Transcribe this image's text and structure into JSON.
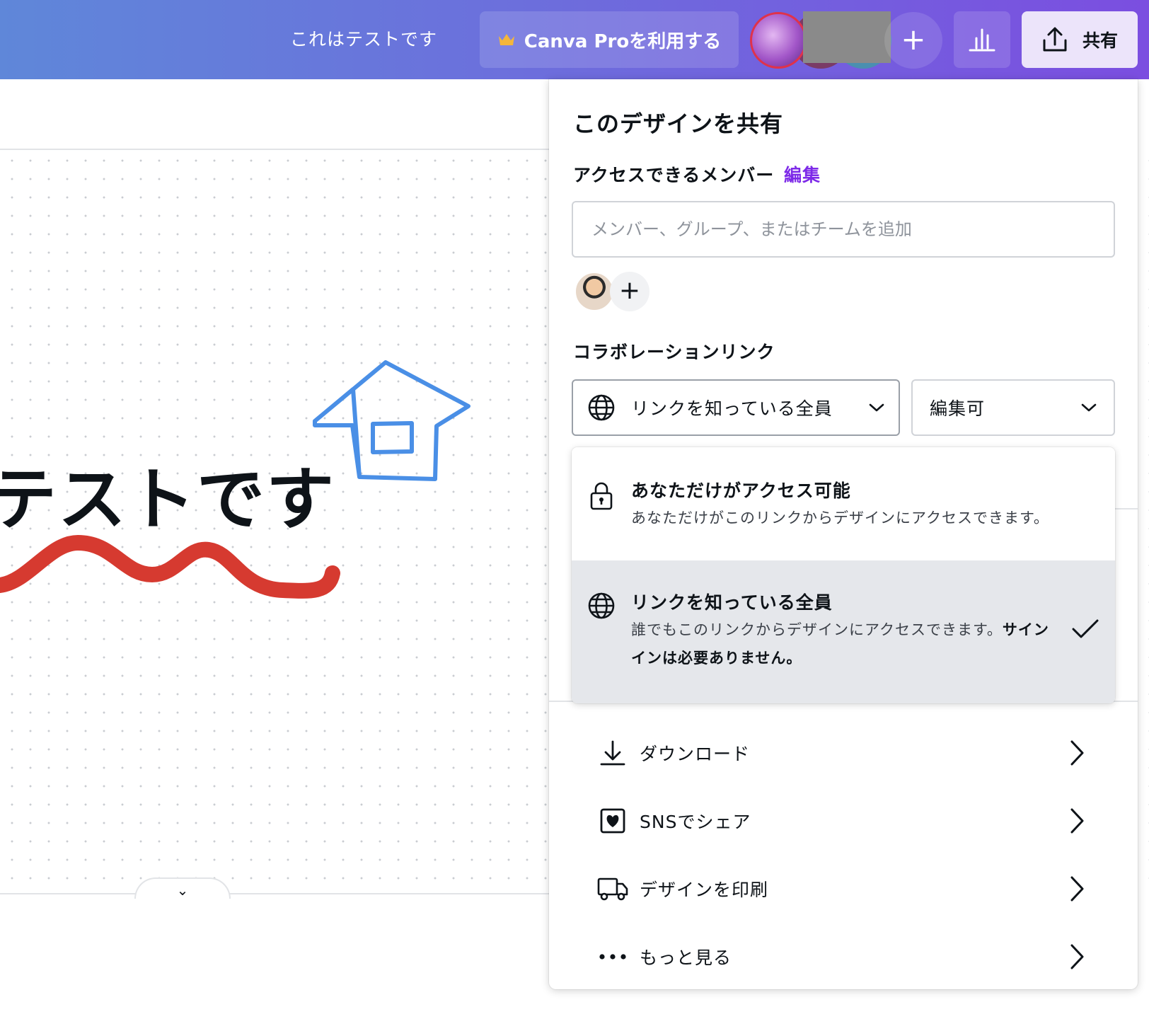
{
  "topbar": {
    "doc_title": "これはテストです",
    "pro_button": "Canva Proを利用する",
    "add_icon": "plus-icon",
    "insights_icon": "bar-chart-icon",
    "share_button": "共有",
    "share_icon": "upload-icon"
  },
  "canvas": {
    "text": "テストです",
    "collapse_icon": "⌄"
  },
  "share_panel": {
    "title": "このデザインを共有",
    "members_label": "アクセスできるメンバー",
    "members_edit": "編集",
    "member_input_placeholder": "メンバー、グループ、またはチームを追加",
    "add_member_icon": "+",
    "collab_label": "コラボレーションリンク",
    "access_select": "リンクを知っている全員",
    "permission_select": "編集可",
    "access_options": [
      {
        "title": "あなただけがアクセス可能",
        "description": "あなただけがこのリンクからデザインにアクセスできます。",
        "icon": "lock-icon",
        "selected": false
      },
      {
        "title": "リンクを知っている全員",
        "description_plain": "誰でもこのリンクからデザインにアクセスできます。",
        "description_bold": "サインインは必要ありません。",
        "icon": "globe-icon",
        "selected": true
      }
    ],
    "actions": [
      {
        "label": "ダウンロード",
        "icon": "download-icon"
      },
      {
        "label": "SNSでシェア",
        "icon": "heart-frame-icon"
      },
      {
        "label": "デザインを印刷",
        "icon": "truck-icon"
      },
      {
        "label": "もっと見る",
        "icon": "more-dots-icon"
      }
    ]
  },
  "colors": {
    "topbar_gradient_start": "#5f87d9",
    "topbar_gradient_end": "#7b4ee0",
    "accent_purple": "#7d2ae8",
    "share_button_bg": "#ece4fa",
    "selected_option_bg": "#e5e7eb",
    "stroke_blue": "#4a8fe6",
    "stroke_red": "#d63a30"
  }
}
